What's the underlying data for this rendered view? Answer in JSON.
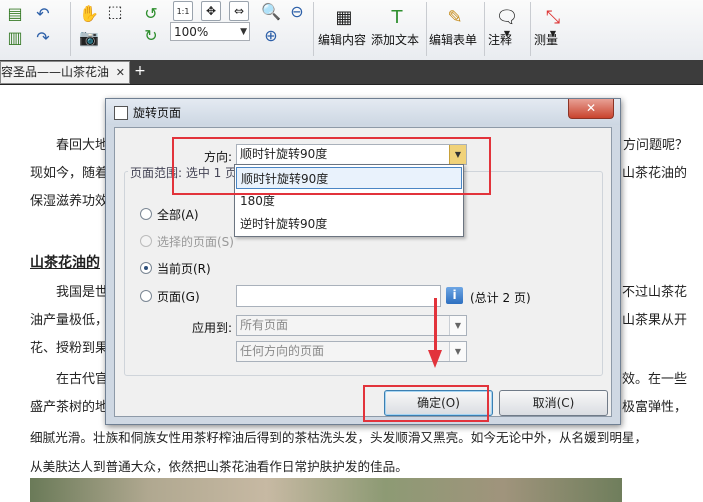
{
  "toolbar": {
    "zoom_value": "100%",
    "buttons": [
      {
        "label": "编辑内容"
      },
      {
        "label": "添加文本"
      },
      {
        "label": "编辑表单"
      },
      {
        "label": "注释"
      },
      {
        "label": "测量"
      }
    ],
    "fit_label": "1:1"
  },
  "tabs": [
    {
      "label": "容圣品——山茶花油",
      "close": "✕"
    }
  ],
  "tab_add": "+",
  "document": {
    "line1_left": "春回大地",
    "line1_right": "方问题呢？",
    "line2_left": "现如今，随着",
    "line2_right": "山茶花油的",
    "line3": "保湿滋养功效",
    "heading": "山茶花油的",
    "line5_left": "我国是世",
    "line5_right": "不过山茶花",
    "line6_left": "油产量极低，",
    "line6_right": "山茶果从开",
    "line7": "花、授粉到果",
    "line8_left": "在古代官",
    "line8_right": "效。在一些",
    "line9_left": "盛产茶树的地",
    "line9_right": "极富弹性，",
    "line10": "细腻光滑。壮族和侗族女性用茶籽榨油后得到的茶枯洗头发，头发顺滑又黑亮。如今无论中外，从名媛到明星，",
    "line11": "从美肤达人到普通大众，依然把山茶花油看作日常护肤护发的佳品。"
  },
  "dialog": {
    "title": "旋转页面",
    "direction_label": "方向:",
    "direction_value": "顺时针旋转90度",
    "range_title": "页面范围: 选中 1 页",
    "radio_all": "全部(A)",
    "radio_selected": "选择的页面(S)",
    "radio_current": "当前页(R)",
    "radio_pages": "页面(G)",
    "pages_input": "",
    "total_label": "(总计 2 页)",
    "apply_label": "应用到:",
    "apply_value": "所有页面",
    "orientation_value": "任何方向的页面",
    "info_glyph": "i",
    "ok_label": "确定(O)",
    "cancel_label": "取消(C)",
    "close_glyph": "✕",
    "dropdown_options": [
      "顺时针旋转90度",
      "180度",
      "逆时针旋转90度"
    ]
  },
  "colors": {
    "annotation_red": "#e2333b",
    "accent_blue": "#2d6fc0"
  }
}
